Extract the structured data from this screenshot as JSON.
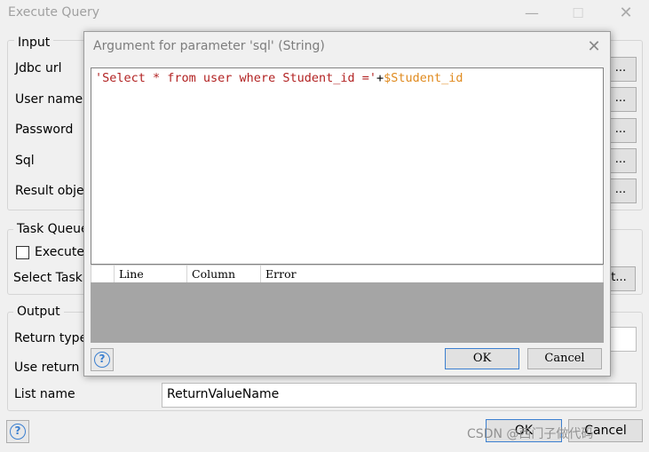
{
  "window": {
    "title": "Execute Query",
    "controls": {
      "minimize": "—",
      "maximize": "☐",
      "close": "✕"
    }
  },
  "input_group": {
    "legend": "Input",
    "labels": [
      "Jdbc url",
      "User name",
      "Password",
      "Sql",
      "Result objec"
    ],
    "button_label": "..."
  },
  "task_queue_group": {
    "legend": "Task Queue",
    "checkbox_label": "Execute",
    "select_label": "Select Task",
    "button_label": "t..."
  },
  "output_group": {
    "legend": "Output",
    "labels": [
      "Return type",
      "Use return v",
      "List name"
    ],
    "list_name_value": "ReturnValueName"
  },
  "footer": {
    "ok_label": "OK",
    "cancel_label": "Cancel"
  },
  "dialog": {
    "title": "Argument for parameter 'sql' (String)",
    "close_glyph": "✕",
    "sql": {
      "string_part": "'Select * from user where Student_id ='",
      "operator": "+",
      "variable": "$Student_id"
    },
    "error_columns": [
      "Line",
      "Column",
      "Error"
    ],
    "ok_label": "OK",
    "cancel_label": "Cancel",
    "help_glyph": "?"
  },
  "watermark": "CSDN @西门子做代码",
  "colors": {
    "string": "#b22222",
    "variable": "#e08a1e",
    "accent": "#3b7fd0"
  }
}
